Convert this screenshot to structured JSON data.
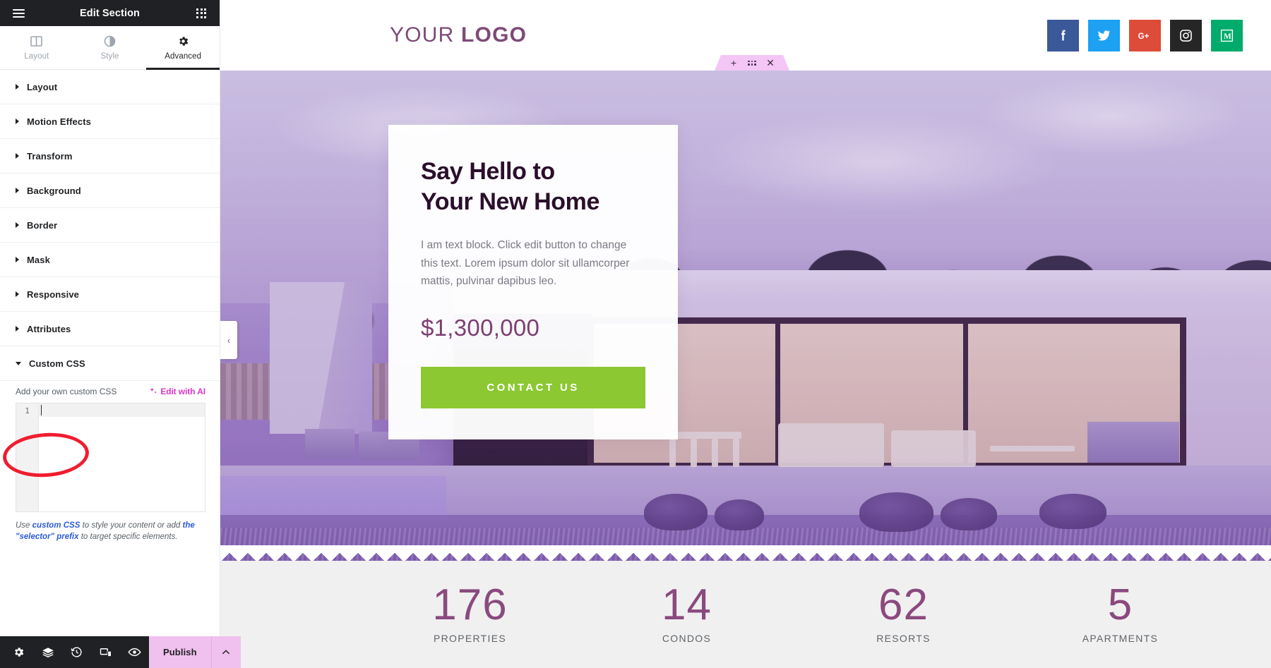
{
  "panel": {
    "header": {
      "title": "Edit Section",
      "menu_icon": "hamburger-menu-icon",
      "apps_icon": "grid-apps-icon"
    },
    "tabs": [
      {
        "label": "Layout",
        "icon": "layout-columns-icon",
        "active": false
      },
      {
        "label": "Style",
        "icon": "contrast-circle-icon",
        "active": false
      },
      {
        "label": "Advanced",
        "icon": "gear-icon",
        "active": true
      }
    ],
    "sections": [
      {
        "label": "Layout",
        "expanded": false
      },
      {
        "label": "Motion Effects",
        "expanded": false
      },
      {
        "label": "Transform",
        "expanded": false
      },
      {
        "label": "Background",
        "expanded": false
      },
      {
        "label": "Border",
        "expanded": false
      },
      {
        "label": "Mask",
        "expanded": false
      },
      {
        "label": "Responsive",
        "expanded": false
      },
      {
        "label": "Attributes",
        "expanded": false
      },
      {
        "label": "Custom CSS",
        "expanded": true
      }
    ],
    "custom_css": {
      "field_label": "Add your own custom CSS",
      "ai_link": "Edit with AI",
      "ai_icon": "sparkle-ai-icon",
      "line_number": "1",
      "editor_value": "",
      "hint_prefix": "Use ",
      "hint_link_1": "custom CSS",
      "hint_middle": " to style your content or add ",
      "hint_link_2": "the \"selector\" prefix",
      "hint_suffix": " to target specific elements."
    },
    "footer": {
      "tools": [
        {
          "name": "settings-gear-icon",
          "label": "Settings"
        },
        {
          "name": "layers-navigator-icon",
          "label": "Navigator"
        },
        {
          "name": "history-clock-icon",
          "label": "History"
        },
        {
          "name": "responsive-device-icon",
          "label": "Responsive Mode"
        },
        {
          "name": "eye-preview-icon",
          "label": "Preview Changes"
        }
      ],
      "publish_label": "Publish",
      "publish_arrow_icon": "chevron-up-icon"
    },
    "annotation": {
      "shape": "red-ellipse",
      "color": "#f01d2f",
      "target": "Custom CSS"
    },
    "collapse_handle_icon": "chevron-left-icon"
  },
  "canvas": {
    "section_handle": {
      "add_icon": "plus-icon",
      "drag_icon": "drag-dots-icon",
      "close_icon": "close-x-icon",
      "color": "#f3c6f5"
    },
    "site_header": {
      "logo_light": "YOUR",
      "logo_bold": "LOGO",
      "logo_color": "#7e4a77",
      "socials": [
        {
          "name": "facebook-icon",
          "label": "f",
          "color": "#3b5998"
        },
        {
          "name": "twitter-icon",
          "label": "t",
          "color": "#1da1f2"
        },
        {
          "name": "google-plus-icon",
          "label": "G+",
          "color": "#dd4b39"
        },
        {
          "name": "instagram-icon",
          "label": "ig",
          "color": "#262626"
        },
        {
          "name": "medium-icon",
          "label": "M",
          "color": "#00ab6c"
        }
      ]
    },
    "hero": {
      "title_line_1": "Say Hello to",
      "title_line_2": "Your New Home",
      "description": "I am text block. Click edit button to change this text. Lorem ipsum dolor sit ullamcorper mattis, pulvinar dapibus leo.",
      "price": "$1,300,000",
      "cta_label": "CONTACT US",
      "cta_color": "#8bc832",
      "price_color": "#7c3f72"
    },
    "stats": [
      {
        "value": "176",
        "label": "PROPERTIES"
      },
      {
        "value": "14",
        "label": "CONDOS"
      },
      {
        "value": "62",
        "label": "RESORTS"
      },
      {
        "value": "5",
        "label": "APARTMENTS"
      }
    ]
  }
}
